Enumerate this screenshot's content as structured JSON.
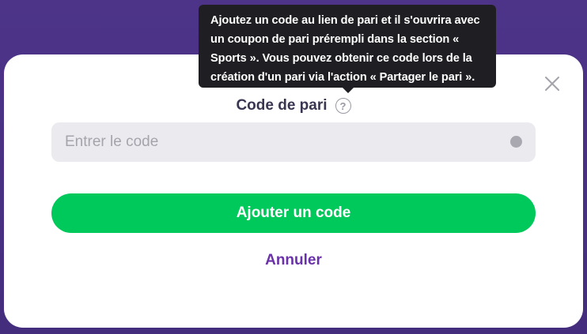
{
  "dialog": {
    "field_label": "Code de pari",
    "help_icon_glyph": "?",
    "input_placeholder": "Entrer le code",
    "input_value": "",
    "submit_label": "Ajouter un code",
    "cancel_label": "Annuler",
    "close_icon": "close-icon"
  },
  "tooltip": {
    "text": "Ajoutez un code au lien de pari et il s'ouvrira avec un coupon de pari prérempli dans la section « Sports ». Vous pouvez obtenir ce code lors de la création d'un pari via l'action « Partager le pari »."
  },
  "colors": {
    "backdrop": "#4b3285",
    "accent_green": "#00c95b",
    "link_purple": "#6a32a8",
    "tooltip_bg": "#1f1f23"
  }
}
